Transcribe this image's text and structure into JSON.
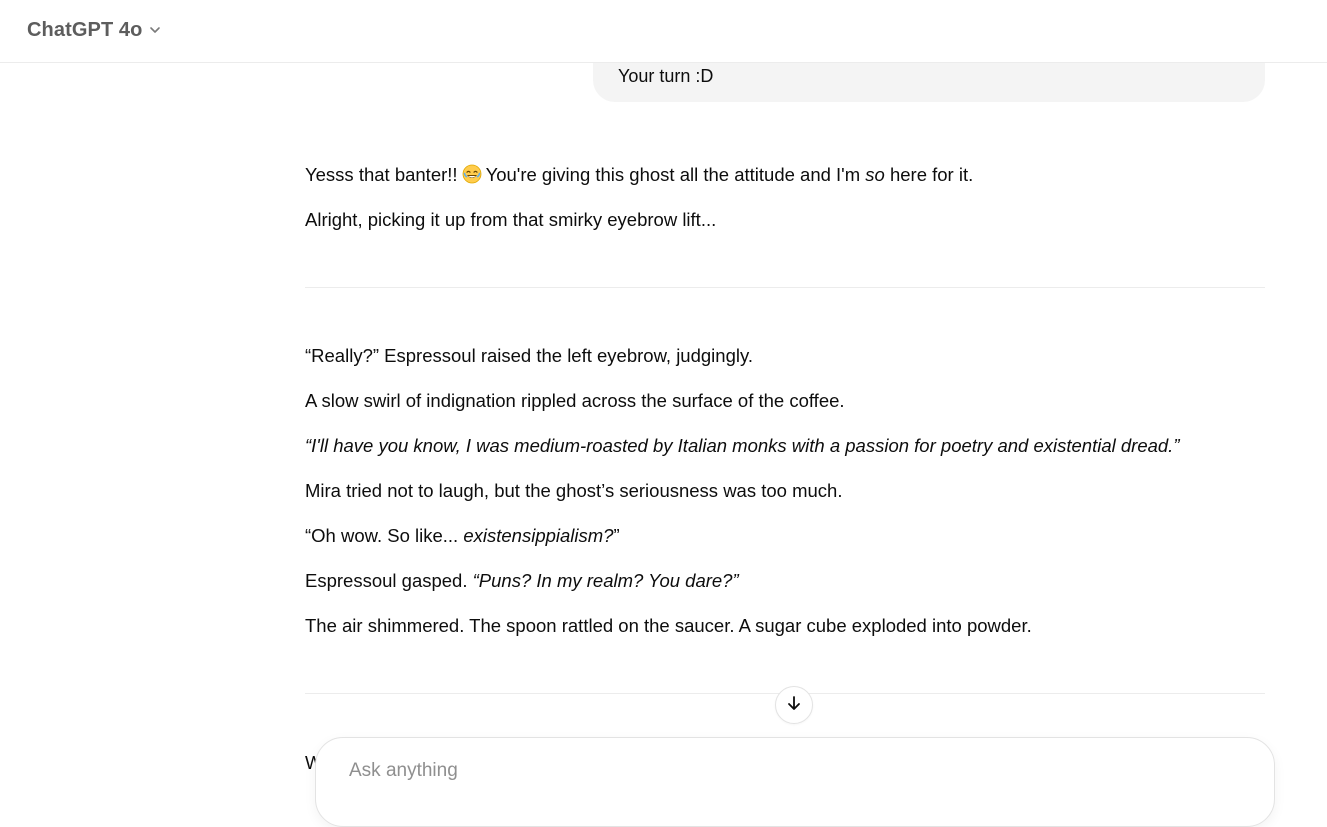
{
  "header": {
    "model_name": "ChatGPT 4o"
  },
  "user_message": {
    "text": "Your turn :D"
  },
  "assistant": {
    "intro_1_before": "Yesss that banter!!",
    "intro_1_after": "You're giving this ghost all the attitude and I'm",
    "intro_1_em": "so",
    "intro_1_end": "here for it.",
    "intro_2": "Alright, picking it up from that smirky eyebrow lift...",
    "story": {
      "p1": "“Really?” Espressoul raised the left eyebrow, judgingly.",
      "p2": "A slow swirl of indignation rippled across the surface of the coffee.",
      "p3": "“I'll have you know, I was medium-roasted by Italian monks with a passion for poetry and existential dread.”",
      "p4": "Mira tried not to laugh, but the ghost’s seriousness was too much.",
      "p5_before": "“Oh wow. So like... ",
      "p5_em": "existensippialism?",
      "p5_after": "”",
      "p6_before": "Espressoul gasped. ",
      "p6_em": "“Puns? In my realm? You dare?”",
      "p7": "The air shimmered. The spoon rattled on the saucer. A sugar cube exploded into powder."
    },
    "peek_text": "W"
  },
  "composer": {
    "placeholder": "Ask anything"
  },
  "icons": {
    "model_chevron": "chevron-down-icon",
    "scroll_down": "arrow-down-icon",
    "emoji": "laughing-emoji"
  },
  "colors": {
    "bubble_bg": "#f4f4f4",
    "text": "#0d0d0d",
    "muted": "#5d5d5d",
    "divider": "#ececec"
  }
}
